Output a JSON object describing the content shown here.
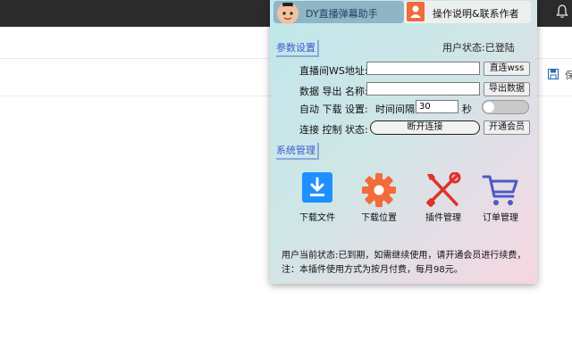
{
  "popup": {
    "tabs": {
      "main_label": "DY直播弹幕助手",
      "help_label": "操作说明&联系作者"
    },
    "params_section": "参数设置",
    "user_status": "用户状态:已登陆",
    "ws": {
      "label": "直播间WS地址:",
      "value": "",
      "button": "直连wss"
    },
    "export": {
      "label": "数据 导出 名称:",
      "value": "",
      "button": "导出数据"
    },
    "auto_download": {
      "label": "自动 下载 设置:",
      "interval_label": "时间间隔",
      "interval_value": "30",
      "unit": "秒",
      "toggle_on": false
    },
    "connection": {
      "label": "连接 控制 状态:",
      "disconnect_button": "断开连接",
      "membership_button": "开通会员"
    },
    "system_section": "系统管理",
    "tools": [
      {
        "label": "下载文件",
        "icon": "download-icon",
        "color": "#1e90ff"
      },
      {
        "label": "下载位置",
        "icon": "gear-icon",
        "color": "#f26b3a"
      },
      {
        "label": "插件管理",
        "icon": "tools-icon",
        "color": "#e0312c"
      },
      {
        "label": "订单管理",
        "icon": "cart-icon",
        "color": "#4a5bc4"
      }
    ],
    "notice": "用户当前状态:已到期，如需继续使用，请开通会员进行续费，注：本插件使用方式为按月付费，每月98元。"
  },
  "browser": {
    "save_partial": "保"
  }
}
